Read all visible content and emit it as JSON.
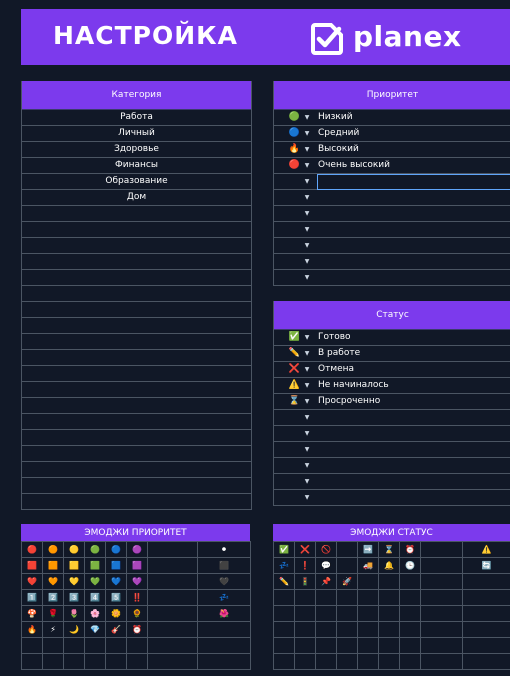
{
  "header": {
    "title": "НАСТРОЙКА",
    "logo_text": "planex"
  },
  "category": {
    "heading": "Категория",
    "items": [
      "Работа",
      "Личный",
      "Здоровье",
      "Финансы",
      "Образование",
      "Дом"
    ]
  },
  "priority": {
    "heading": "Приоритет",
    "items": [
      {
        "icon": "🟢",
        "label": "Низкий"
      },
      {
        "icon": "🔵",
        "label": "Средний"
      },
      {
        "icon": "🔥",
        "label": "Высокий"
      },
      {
        "icon": "🔴",
        "label": "Очень высокий"
      }
    ]
  },
  "status": {
    "heading": "Статус",
    "items": [
      {
        "icon": "✅",
        "label": "Готово"
      },
      {
        "icon": "✏️",
        "label": "В работе"
      },
      {
        "icon": "❌",
        "label": "Отмена"
      },
      {
        "icon": "⚠️",
        "label": "Не начиналось"
      },
      {
        "icon": "⌛",
        "label": "Просроченно"
      }
    ]
  },
  "emoji_priority": {
    "heading": "ЭМОДЖИ ПРИОРИТЕТ",
    "rows": [
      [
        "🔴",
        "🟠",
        "🟡",
        "🟢",
        "🔵",
        "🟣",
        "",
        "⚫"
      ],
      [
        "🟥",
        "🟧",
        "🟨",
        "🟩",
        "🟦",
        "🟪",
        "",
        "⬛"
      ],
      [
        "❤️",
        "🧡",
        "💛",
        "💚",
        "💙",
        "💜",
        "",
        "🖤"
      ],
      [
        "1️⃣",
        "2️⃣",
        "3️⃣",
        "4️⃣",
        "5️⃣",
        "‼️",
        "",
        "💤"
      ],
      [
        "🍄",
        "🌹",
        "🌷",
        "🌸",
        "🌼",
        "🌻",
        "",
        "🌺"
      ],
      [
        "🔥",
        "⚡",
        "🌙",
        "💎",
        "🎸",
        "⏰",
        "",
        ""
      ],
      [
        "",
        "",
        "",
        "",
        "",
        "",
        "",
        ""
      ],
      [
        "",
        "",
        "",
        "",
        "",
        "",
        "",
        ""
      ]
    ]
  },
  "emoji_status": {
    "heading": "ЭМОДЖИ СТАТУС",
    "rows": [
      [
        "✅",
        "❌",
        "🚫",
        "",
        "➡️",
        "⌛",
        "⏰",
        "",
        "⚠️"
      ],
      [
        "💤",
        "❗",
        "💬",
        "",
        "🚚",
        "🔔",
        "🕒",
        "",
        "🔄"
      ],
      [
        "✏️",
        "🚦",
        "📌",
        "🚀",
        "",
        "",
        "",
        "",
        ""
      ],
      [
        "",
        "",
        "",
        "",
        "",
        "",
        "",
        "",
        ""
      ],
      [
        "",
        "",
        "",
        "",
        "",
        "",
        "",
        "",
        ""
      ],
      [
        "",
        "",
        "",
        "",
        "",
        "",
        "",
        "",
        ""
      ],
      [
        "",
        "",
        "",
        "",
        "",
        "",
        "",
        "",
        ""
      ],
      [
        "",
        "",
        "",
        "",
        "",
        "",
        "",
        "",
        ""
      ]
    ]
  }
}
